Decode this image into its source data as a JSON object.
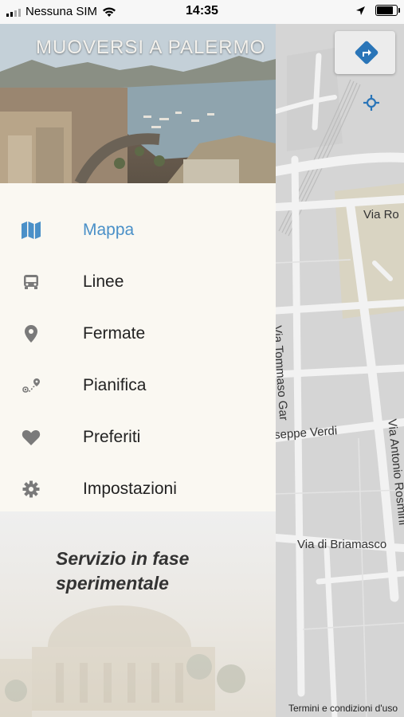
{
  "status_bar": {
    "carrier": "Nessuna SIM",
    "time": "14:35",
    "battery_level": 0.9,
    "icons": [
      "wifi-icon",
      "location-arrow-icon",
      "battery-icon"
    ]
  },
  "drawer": {
    "header_title": "MUOVERSI A PALERMO",
    "menu": [
      {
        "key": "map",
        "label": "Mappa",
        "icon": "map-icon",
        "active": true
      },
      {
        "key": "lines",
        "label": "Linee",
        "icon": "bus-icon",
        "active": false
      },
      {
        "key": "stops",
        "label": "Fermate",
        "icon": "location-pin-icon",
        "active": false
      },
      {
        "key": "plan",
        "label": "Pianifica",
        "icon": "route-icon",
        "active": false
      },
      {
        "key": "favorites",
        "label": "Preferiti",
        "icon": "heart-icon",
        "active": false
      },
      {
        "key": "settings",
        "label": "Impostazioni",
        "icon": "gear-icon",
        "active": false
      }
    ],
    "footer_note": "Servizio in fase sperimentale"
  },
  "map": {
    "streets": [
      "Via Ro",
      "Via Tommaso Gar",
      "Via Antonio Rosmini",
      "seppe Verdi",
      "Via di Briamasco"
    ],
    "footer_link": "Termini e condizioni d'uso",
    "controls": [
      "directions-icon",
      "recenter-icon"
    ]
  },
  "colors": {
    "accent": "#4a90c8",
    "icon_gray": "#7a7a7a",
    "drawer_bg": "#faf8f2",
    "map_bg": "#d6d6d6"
  }
}
